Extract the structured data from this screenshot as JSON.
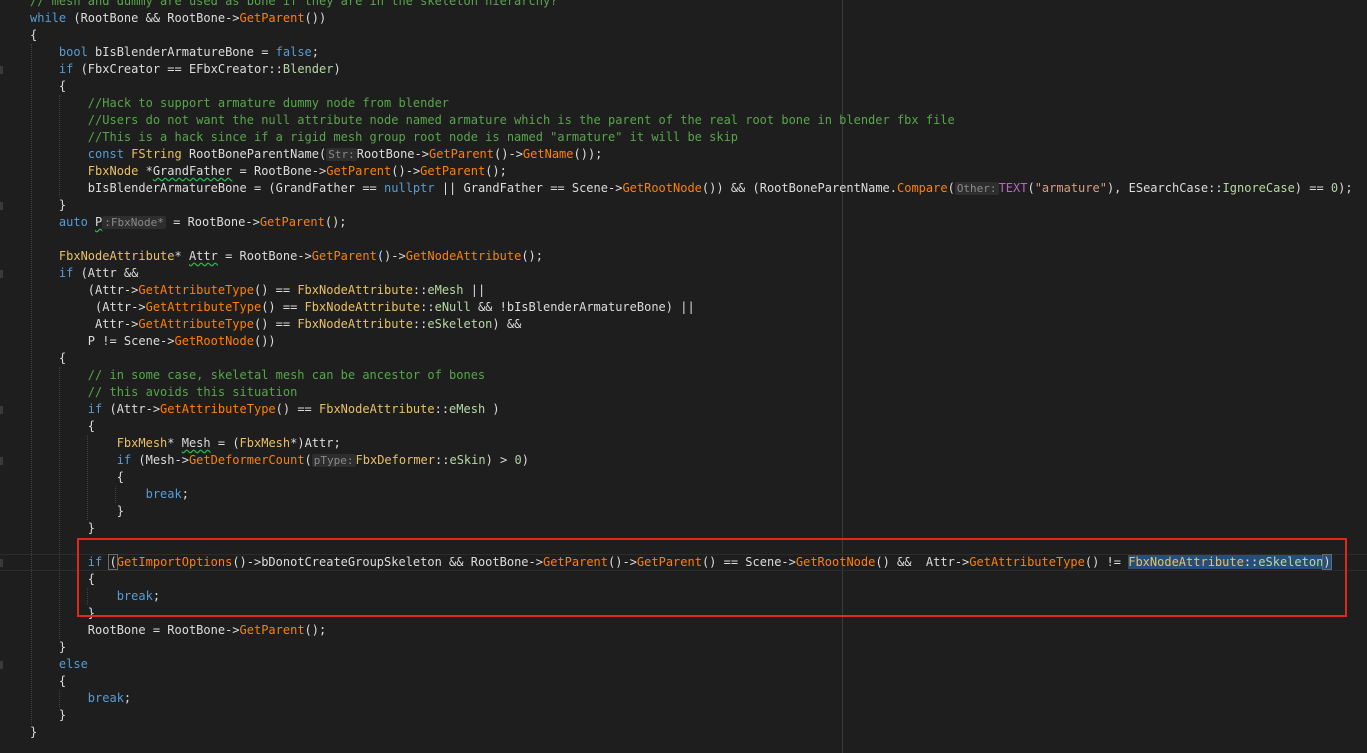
{
  "editor": {
    "highlight_color": "#e0291a",
    "lines": [
      [
        {
          "c": "cm",
          "t": "// mesh and dummy are used as bone if they are in the skeleton hierarchy?"
        }
      ],
      [
        {
          "c": "kw",
          "t": "while"
        },
        {
          "t": " (RootBone && RootBone->"
        },
        {
          "c": "fn",
          "t": "GetParent"
        },
        {
          "t": "())"
        }
      ],
      [
        {
          "t": "{"
        }
      ],
      [
        {
          "t": "    "
        },
        {
          "c": "kw",
          "t": "bool"
        },
        {
          "t": " bIsBlenderArmatureBone = "
        },
        {
          "c": "kw",
          "t": "false"
        },
        {
          "t": ";"
        }
      ],
      [
        {
          "t": "    "
        },
        {
          "c": "kw",
          "t": "if"
        },
        {
          "t": " (FbxCreator == EFbxCreator::"
        },
        {
          "c": "en",
          "t": "Blender"
        },
        {
          "t": ")"
        }
      ],
      [
        {
          "t": "    {"
        }
      ],
      [
        {
          "t": "        "
        },
        {
          "c": "cm",
          "t": "//Hack to support armature dummy node from blender"
        }
      ],
      [
        {
          "t": "        "
        },
        {
          "c": "cm",
          "t": "//Users do not want the null attribute node named armature which is the parent of the real root bone in blender fbx file"
        }
      ],
      [
        {
          "t": "        "
        },
        {
          "c": "cm",
          "t": "//This is a hack since if a rigid mesh group root node is named \"armature\" it will be skip"
        }
      ],
      [
        {
          "t": "        "
        },
        {
          "c": "kw",
          "t": "const"
        },
        {
          "t": " "
        },
        {
          "c": "cls",
          "t": "FString"
        },
        {
          "t": " RootBoneParentName("
        },
        {
          "c": "hint",
          "t": "Str:"
        },
        {
          "t": "RootBone->"
        },
        {
          "c": "fn",
          "t": "GetParent"
        },
        {
          "t": "()->"
        },
        {
          "c": "fn",
          "t": "GetName"
        },
        {
          "t": "());"
        }
      ],
      [
        {
          "t": "        "
        },
        {
          "c": "cls",
          "t": "FbxNode"
        },
        {
          "t": " *"
        },
        {
          "c": "squig",
          "t": "GrandFather"
        },
        {
          "t": " = RootBone->"
        },
        {
          "c": "fn",
          "t": "GetParent"
        },
        {
          "t": "()->"
        },
        {
          "c": "fn",
          "t": "GetParent"
        },
        {
          "t": "();"
        }
      ],
      [
        {
          "t": "        bIsBlenderArmatureBone = (GrandFather == "
        },
        {
          "c": "kw",
          "t": "nullptr"
        },
        {
          "t": " || GrandFather == Scene->"
        },
        {
          "c": "fn",
          "t": "GetRootNode"
        },
        {
          "t": "()) && (RootBoneParentName."
        },
        {
          "c": "fn",
          "t": "Compare"
        },
        {
          "t": "("
        },
        {
          "c": "hint",
          "t": "Other:"
        },
        {
          "c": "mc",
          "t": "TEXT"
        },
        {
          "t": "("
        },
        {
          "c": "st",
          "t": "\"armature\""
        },
        {
          "t": "), ESearchCase::"
        },
        {
          "c": "en",
          "t": "IgnoreCase"
        },
        {
          "t": ") == "
        },
        {
          "c": "nu",
          "t": "0"
        },
        {
          "t": ");"
        }
      ],
      [
        {
          "t": "    }"
        }
      ],
      [
        {
          "t": "    "
        },
        {
          "c": "kw",
          "t": "auto"
        },
        {
          "t": " "
        },
        {
          "c": "squig",
          "t": "P"
        },
        {
          "c": "hint",
          "t": ":FbxNode*"
        },
        {
          "t": " = RootBone->"
        },
        {
          "c": "fn",
          "t": "GetParent"
        },
        {
          "t": "();"
        }
      ],
      [
        {
          "t": ""
        }
      ],
      [
        {
          "t": "    "
        },
        {
          "c": "cls",
          "t": "FbxNodeAttribute"
        },
        {
          "t": "* "
        },
        {
          "c": "squig",
          "t": "Attr"
        },
        {
          "t": " = RootBone->"
        },
        {
          "c": "fn",
          "t": "GetParent"
        },
        {
          "t": "()->"
        },
        {
          "c": "fn",
          "t": "GetNodeAttribute"
        },
        {
          "t": "();"
        }
      ],
      [
        {
          "t": "    "
        },
        {
          "c": "kw",
          "t": "if"
        },
        {
          "t": " (Attr &&"
        }
      ],
      [
        {
          "t": "        (Attr->"
        },
        {
          "c": "fn",
          "t": "GetAttributeType"
        },
        {
          "t": "() == "
        },
        {
          "c": "cls",
          "t": "FbxNodeAttribute"
        },
        {
          "t": "::"
        },
        {
          "c": "en",
          "t": "eMesh"
        },
        {
          "t": " ||"
        }
      ],
      [
        {
          "t": "         (Attr->"
        },
        {
          "c": "fn",
          "t": "GetAttributeType"
        },
        {
          "t": "() == "
        },
        {
          "c": "cls",
          "t": "FbxNodeAttribute"
        },
        {
          "t": "::"
        },
        {
          "c": "en",
          "t": "eNull"
        },
        {
          "t": " && !bIsBlenderArmatureBone) ||"
        }
      ],
      [
        {
          "t": "         Attr->"
        },
        {
          "c": "fn",
          "t": "GetAttributeType"
        },
        {
          "t": "() == "
        },
        {
          "c": "cls",
          "t": "FbxNodeAttribute"
        },
        {
          "t": "::"
        },
        {
          "c": "en",
          "t": "eSkeleton"
        },
        {
          "t": ") &&"
        }
      ],
      [
        {
          "t": "        P != Scene->"
        },
        {
          "c": "fn",
          "t": "GetRootNode"
        },
        {
          "t": "())"
        }
      ],
      [
        {
          "t": "    {"
        }
      ],
      [
        {
          "t": "        "
        },
        {
          "c": "cm",
          "t": "// in some case, skeletal mesh can be ancestor of bones"
        }
      ],
      [
        {
          "t": "        "
        },
        {
          "c": "cm",
          "t": "// this avoids this situation"
        }
      ],
      [
        {
          "t": "        "
        },
        {
          "c": "kw",
          "t": "if"
        },
        {
          "t": " (Attr->"
        },
        {
          "c": "fn",
          "t": "GetAttributeType"
        },
        {
          "t": "() == "
        },
        {
          "c": "cls",
          "t": "FbxNodeAttribute"
        },
        {
          "t": "::"
        },
        {
          "c": "en",
          "t": "eMesh"
        },
        {
          "t": " )"
        }
      ],
      [
        {
          "t": "        {"
        }
      ],
      [
        {
          "t": "            "
        },
        {
          "c": "cls",
          "t": "FbxMesh"
        },
        {
          "t": "* "
        },
        {
          "c": "squig",
          "t": "Mesh"
        },
        {
          "t": " = ("
        },
        {
          "c": "cls",
          "t": "FbxMesh"
        },
        {
          "t": "*)Attr;"
        }
      ],
      [
        {
          "t": "            "
        },
        {
          "c": "kw",
          "t": "if"
        },
        {
          "t": " (Mesh->"
        },
        {
          "c": "fn",
          "t": "GetDeformerCount"
        },
        {
          "t": "("
        },
        {
          "c": "hint",
          "t": "pType:"
        },
        {
          "c": "cls",
          "t": "FbxDeformer"
        },
        {
          "t": "::"
        },
        {
          "c": "en",
          "t": "eSkin"
        },
        {
          "t": ") > "
        },
        {
          "c": "nu",
          "t": "0"
        },
        {
          "t": ")"
        }
      ],
      [
        {
          "t": "            {"
        }
      ],
      [
        {
          "t": "                "
        },
        {
          "c": "kw",
          "t": "break"
        },
        {
          "t": ";"
        }
      ],
      [
        {
          "t": "            }"
        }
      ],
      [
        {
          "t": "        }"
        }
      ],
      [
        {
          "t": ""
        }
      ],
      [
        {
          "t": "        "
        },
        {
          "c": "kw",
          "t": "if"
        },
        {
          "t": " "
        },
        {
          "c": "brace-match",
          "t": "("
        },
        {
          "c": "fn",
          "t": "GetImportOptions"
        },
        {
          "t": "()->bDonotCreateGroupSkeleton && RootBone->"
        },
        {
          "c": "fn",
          "t": "GetParent"
        },
        {
          "t": "()->"
        },
        {
          "c": "fn",
          "t": "GetParent"
        },
        {
          "t": "() == Scene->"
        },
        {
          "c": "fn",
          "t": "GetRootNode"
        },
        {
          "t": "() &&  Attr->"
        },
        {
          "c": "fn",
          "t": "GetAttributeType"
        },
        {
          "t": "() != "
        },
        {
          "c": "cls sel",
          "t": "FbxNodeAttribute"
        },
        {
          "c": "sel",
          "t": "::"
        },
        {
          "c": "en sel",
          "t": "eSkeleton"
        },
        {
          "c": "brace-match sel",
          "t": ")"
        }
      ],
      [
        {
          "t": "        {"
        }
      ],
      [
        {
          "t": "            "
        },
        {
          "c": "kw",
          "t": "break"
        },
        {
          "t": ";"
        }
      ],
      [
        {
          "t": "        }"
        }
      ],
      [
        {
          "t": "        RootBone = RootBone->"
        },
        {
          "c": "fn",
          "t": "GetParent"
        },
        {
          "t": "();"
        }
      ],
      [
        {
          "t": "    }"
        }
      ],
      [
        {
          "t": "    "
        },
        {
          "c": "kw",
          "t": "else"
        }
      ],
      [
        {
          "t": "    {"
        }
      ],
      [
        {
          "t": "        "
        },
        {
          "c": "kw",
          "t": "break"
        },
        {
          "t": ";"
        }
      ],
      [
        {
          "t": "    }"
        }
      ],
      [
        {
          "t": "}"
        }
      ]
    ]
  }
}
